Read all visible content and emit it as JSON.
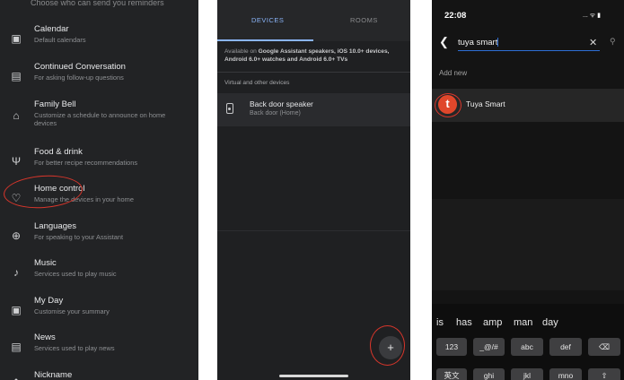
{
  "panel1": {
    "top_fragment": "Choose who can send you reminders",
    "items": [
      {
        "icon": "calendar-icon",
        "glyph": "▣",
        "title": "Calendar",
        "subtitle": "Default calendars"
      },
      {
        "icon": "chat-icon",
        "glyph": "▤",
        "title": "Continued Conversation",
        "subtitle": "For asking follow-up questions"
      },
      {
        "icon": "bell-icon",
        "glyph": "⌂",
        "title": "Family Bell",
        "subtitle": "Customize a schedule to announce on home devices"
      },
      {
        "icon": "fork-knife-icon",
        "glyph": "Ψ",
        "title": "Food & drink",
        "subtitle": "For better recipe recommendations"
      },
      {
        "icon": "lightbulb-icon",
        "glyph": "♡",
        "title": "Home control",
        "subtitle": "Manage the devices in your home"
      },
      {
        "icon": "globe-icon",
        "glyph": "⊕",
        "title": "Languages",
        "subtitle": "For speaking to your Assistant"
      },
      {
        "icon": "music-note-icon",
        "glyph": "♪",
        "title": "Music",
        "subtitle": "Services used to play music"
      },
      {
        "icon": "my-day-icon",
        "glyph": "▣",
        "title": "My Day",
        "subtitle": "Customise your summary"
      },
      {
        "icon": "news-icon",
        "glyph": "▤",
        "title": "News",
        "subtitle": "Services used to play news"
      },
      {
        "icon": "person-icon",
        "glyph": "●",
        "title": "Nickname",
        "subtitle": ""
      }
    ]
  },
  "panel2": {
    "tabs": [
      {
        "label": "DEVICES",
        "active": true
      },
      {
        "label": "ROOMS",
        "active": false
      }
    ],
    "info_prefix": "Available on ",
    "info_bold": "Google Assistant speakers, iOS 10.0+ devices, Android 6.0+ watches and Android 6.0+ TVs",
    "section": "Virtual and other devices",
    "device": {
      "icon": "speaker-icon",
      "name": "Back door speaker",
      "location": "Back door (Home)"
    },
    "fab_label": "+"
  },
  "panel3": {
    "time": "22:08",
    "status": "... ᯤ ▮",
    "search_value": "tuya smart",
    "add_new": "Add new",
    "result": {
      "logo": "t",
      "name": "Tuya Smart"
    },
    "suggestions": [
      "is",
      "has",
      "amp",
      "man",
      "day"
    ],
    "keys_row1": [
      "123",
      "_@/#",
      "abc",
      "def",
      "⌫"
    ],
    "keys_row2": [
      "英文",
      "ghi",
      "jkl",
      "mno",
      "⇧"
    ]
  },
  "colors": {
    "accent": "#8ab4f8",
    "highlight_ring": "#d9362b",
    "tuya_brand": "#e0472b"
  }
}
